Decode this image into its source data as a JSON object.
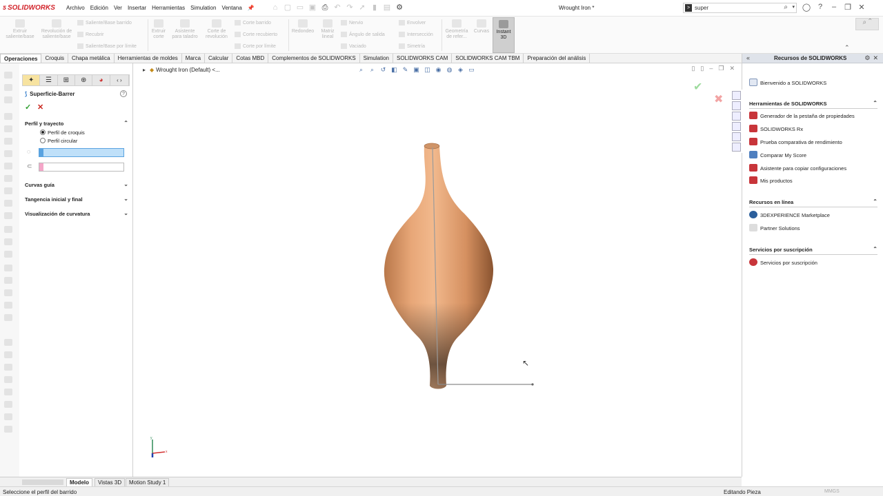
{
  "app": {
    "brand": "SOLIDWORKS",
    "document_title": "Wrought Iron *"
  },
  "menu": [
    "Archivo",
    "Edición",
    "Ver",
    "Insertar",
    "Herramientas",
    "Simulation",
    "Ventana"
  ],
  "search": {
    "value": "super"
  },
  "command_manager": {
    "extrude_boss": "Extruir saliente/base",
    "revolve_boss": "Revolución de saliente/base",
    "swept_boss": "Saliente/Base barrido",
    "lofted_boss": "Recubrir",
    "boundary_boss": "Saliente/Base por límite",
    "extrude_cut": "Extruir corte",
    "hole_wizard": "Asistente para taladro",
    "revolve_cut": "Corte de revolución",
    "swept_cut": "Corte barrido",
    "lofted_cut": "Corte recubierto",
    "boundary_cut": "Corte por límite",
    "fillet": "Redondeo",
    "linear_pattern": "Matriz lineal",
    "rib": "Nervio",
    "draft": "Ángulo de salida",
    "shell": "Vaciado",
    "wrap": "Envolver",
    "intersect": "Intersección",
    "mirror": "Simetría",
    "ref_geometry": "Geometría de refer...",
    "curves": "Curvas",
    "instant3d": "Instant 3D"
  },
  "tabs": [
    "Operaciones",
    "Croquis",
    "Chapa metálica",
    "Herramientas de moldes",
    "Marca",
    "Calcular",
    "Cotas MBD",
    "Complementos de SOLIDWORKS",
    "Simulation",
    "SOLIDWORKS CAM",
    "SOLIDWORKS CAM TBM",
    "Preparación del análisis"
  ],
  "property_manager": {
    "title": "Superficie-Barrer",
    "help": "?",
    "section_profile_path": "Perfil y trayecto",
    "option_sketch_profile": "Perfil de croquis",
    "option_circular_profile": "Perfil circular",
    "section_guide_curves": "Curvas guía",
    "section_tangency": "Tangencia inicial y final",
    "section_curvature": "Visualización de curvatura"
  },
  "viewport": {
    "breadcrumb": "Wrought Iron (Default) <..."
  },
  "task_pane": {
    "title": "Recursos de SOLIDWORKS",
    "welcome": "Bienvenido a SOLIDWORKS",
    "section_tools": "Herramientas de SOLIDWORKS",
    "tools": [
      "Generador de la pestaña de propiedades",
      "SOLIDWORKS Rx",
      "Prueba comparativa de rendimiento",
      "Comparar My Score",
      "Asistente para copiar configuraciones",
      "Mis productos"
    ],
    "section_online": "Recursos en línea",
    "online": [
      "3DEXPERIENCE Marketplace",
      "Partner Solutions"
    ],
    "section_subscription": "Servicios por suscripción",
    "subscription": [
      "Servicios por suscripción"
    ]
  },
  "bottom_tabs": [
    "Modelo",
    "Vistas 3D",
    "Motion Study 1"
  ],
  "status": {
    "message": "Seleccione el perfil del barrido",
    "mode": "Editando Pieza",
    "units": "MMGS"
  },
  "colors": {
    "accent": "#d2232a",
    "model": "#e0a070",
    "selection_blue": "#bfe0f9",
    "selection_pink": "#f4a6c8"
  }
}
